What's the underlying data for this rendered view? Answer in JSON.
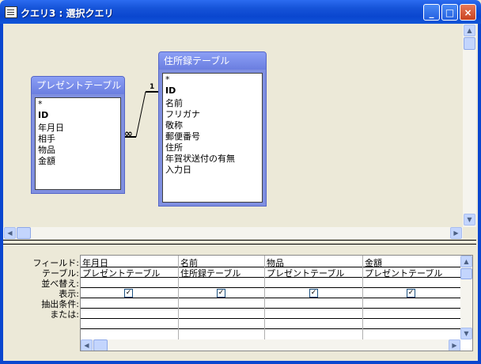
{
  "window": {
    "title": "クエリ3 : 選択クエリ",
    "min_label": "_",
    "max_label": "□",
    "close_label": "×"
  },
  "tables": [
    {
      "name": "プレゼントテーブル",
      "fields": [
        "*",
        "ID",
        "年月日",
        "相手",
        "物品",
        "金額"
      ]
    },
    {
      "name": "住所録テーブル",
      "fields": [
        "*",
        "ID",
        "名前",
        "フリガナ",
        "敬称",
        "郵便番号",
        "住所",
        "年賀状送付の有無",
        "入力日"
      ]
    }
  ],
  "relationship": {
    "one_label": "1",
    "many_label": "∞"
  },
  "grid": {
    "row_labels": [
      "フィールド:",
      "テーブル:",
      "並べ替え:",
      "表示:",
      "抽出条件:",
      "または:"
    ],
    "columns": [
      {
        "field": "年月日",
        "table": "プレゼントテーブル",
        "show": true
      },
      {
        "field": "名前",
        "table": "住所録テーブル",
        "show": true
      },
      {
        "field": "物品",
        "table": "プレゼントテーブル",
        "show": true
      },
      {
        "field": "金額",
        "table": "プレゼントテーブル",
        "show": true
      }
    ]
  },
  "icons": {
    "check": "✓",
    "scroll_up": "▲",
    "scroll_down": "▼",
    "scroll_left": "◀",
    "scroll_right": "▶"
  },
  "colors": {
    "titlebar": "#0a46cf",
    "table_header": "#7f8fe0"
  }
}
